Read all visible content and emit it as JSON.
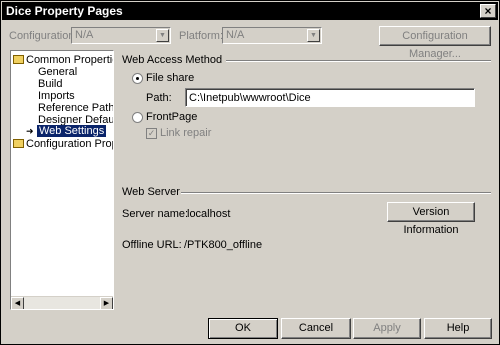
{
  "window": {
    "title": "Dice Property Pages",
    "close_glyph": "×"
  },
  "toolbar": {
    "configuration_label": "Configuration:",
    "configuration_value": "N/A",
    "platform_label": "Platform:",
    "platform_value": "N/A",
    "config_manager_label": "Configuration Manager..."
  },
  "tree": {
    "root": "Common Properties",
    "items": [
      "General",
      "Build",
      "Imports",
      "Reference Path",
      "Designer Defaults",
      "Web Settings"
    ],
    "selected": "Web Settings",
    "second_root": "Configuration Properties"
  },
  "web_access": {
    "section_title": "Web Access Method",
    "file_share_label": "File share",
    "path_label": "Path:",
    "path_value": "C:\\Inetpub\\wwwroot\\Dice",
    "frontpage_label": "FrontPage",
    "link_repair_label": "Link repair"
  },
  "web_server": {
    "section_title": "Web Server",
    "server_name_label": "Server name:",
    "server_name_value": "localhost",
    "version_button": "Version Information",
    "offline_url_label": "Offline URL:",
    "offline_url_value": "/PTK800_offline"
  },
  "footer": {
    "ok": "OK",
    "cancel": "Cancel",
    "apply": "Apply",
    "help": "Help"
  }
}
